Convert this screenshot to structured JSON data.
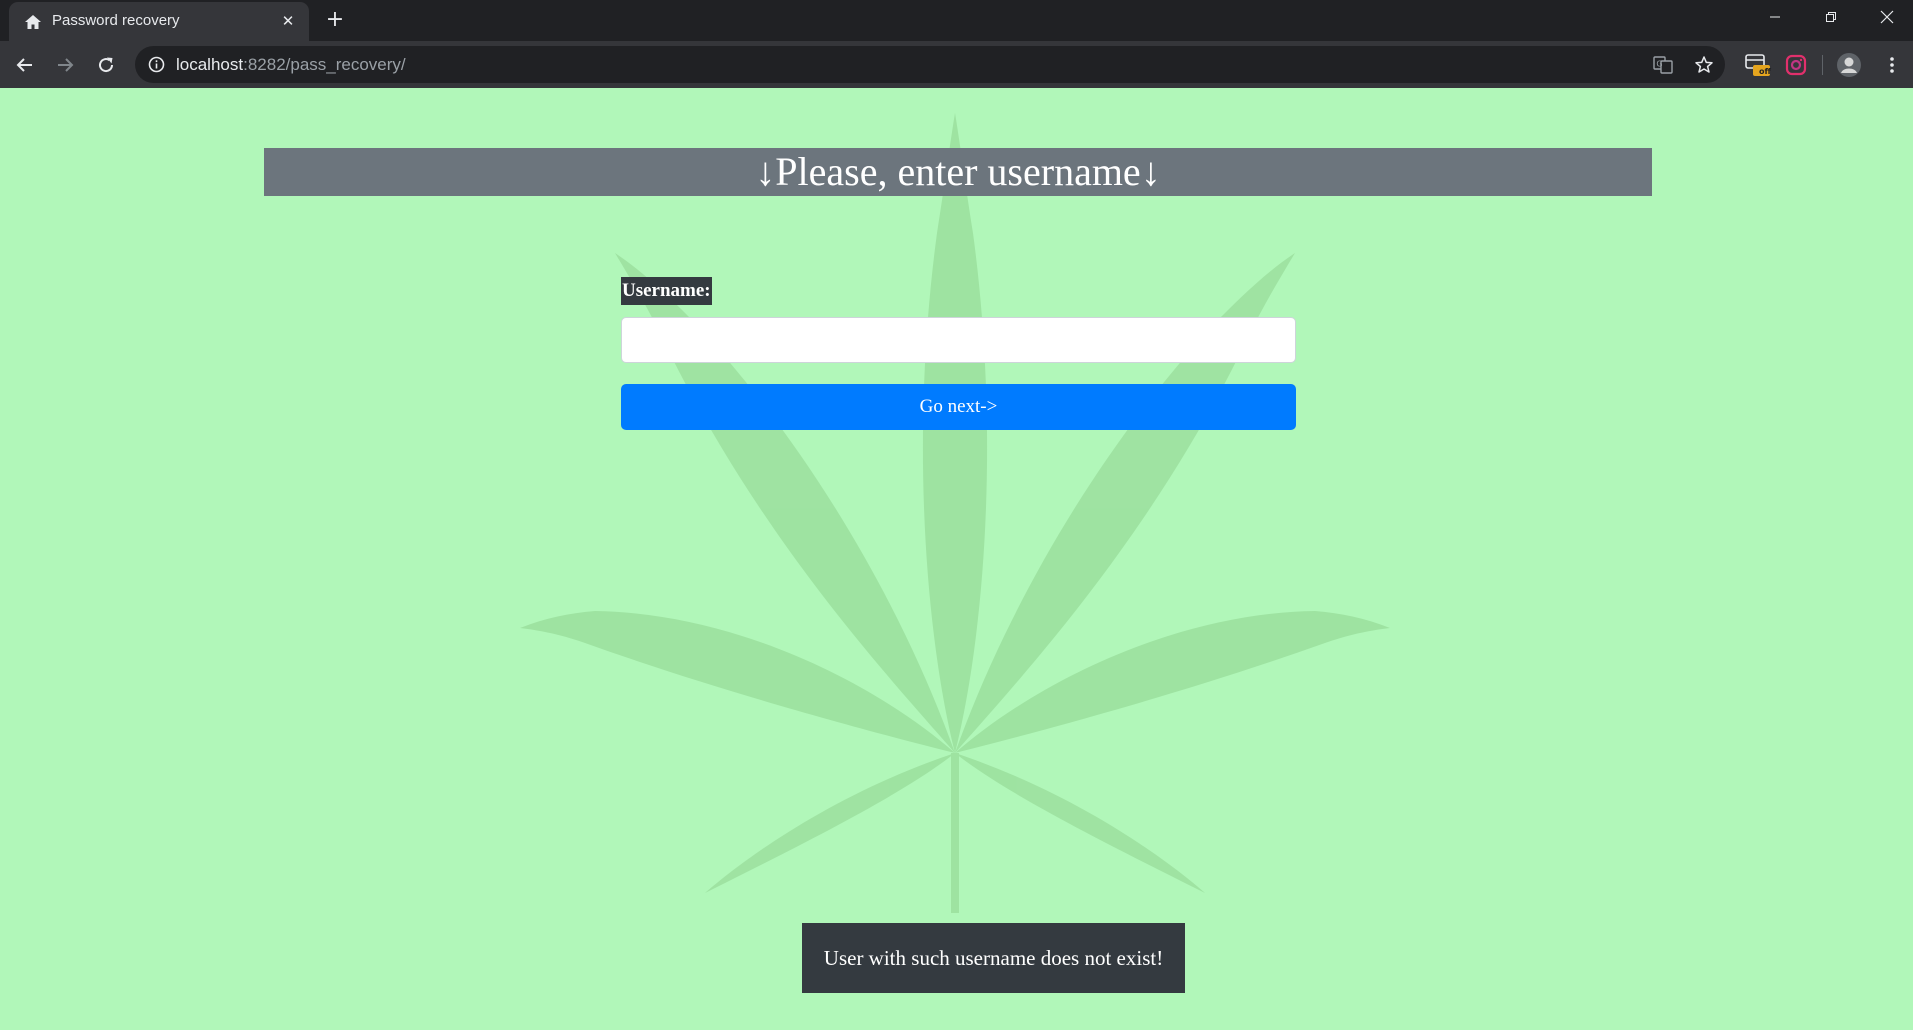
{
  "browser": {
    "tab": {
      "title": "Password recovery",
      "icon": "home-icon"
    },
    "address": {
      "host": "localhost",
      "rest": ":8282/pass_recovery/"
    },
    "extension_badge": "off"
  },
  "page": {
    "banner": "↓Please, enter username↓",
    "username_label": "Username:",
    "username_value": "",
    "submit_label": "Go next->",
    "error_message": "User with such username does not exist!"
  },
  "colors": {
    "page_background": "#b1f7b9",
    "banner_background": "#6c757d",
    "button_primary": "#007bff",
    "label_background": "#343a40",
    "toast_background": "#343a40"
  }
}
